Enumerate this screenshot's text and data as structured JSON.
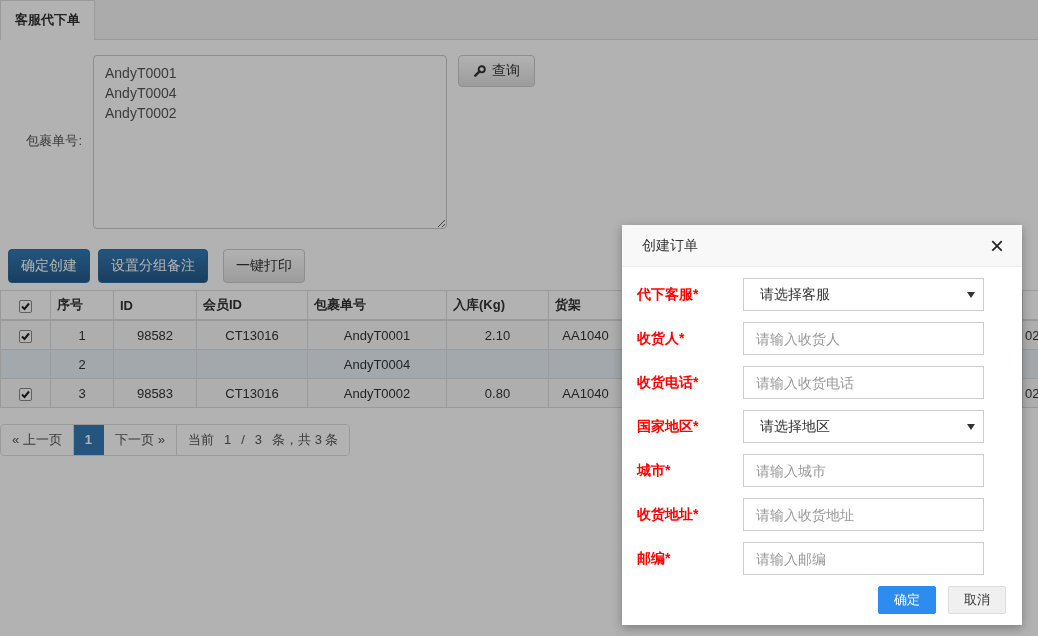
{
  "tabs": [
    {
      "label": "客服代下单",
      "selected": true
    }
  ],
  "search": {
    "label": "包裹单号:",
    "value": "AndyT0001\nAndyT0004\nAndyT0002",
    "button": "查询"
  },
  "actions": [
    {
      "label": "确定创建",
      "kind": "primary"
    },
    {
      "label": "设置分组备注",
      "kind": "primary"
    },
    {
      "label": "一键打印",
      "kind": "default"
    }
  ],
  "table": {
    "header_checked": true,
    "columns": [
      "序号",
      "ID",
      "会员ID",
      "包裹单号",
      "入库(Kg)",
      "货架"
    ],
    "rows": [
      {
        "kind": "found",
        "checked": true,
        "cells": [
          "1",
          "98582",
          "CT13016",
          "AndyT0001",
          "2.10",
          "AA1040"
        ],
        "edge_cell": "02"
      },
      {
        "kind": "missing",
        "cells": [
          "2",
          null,
          null,
          "AndyT0004",
          null,
          null
        ]
      },
      {
        "kind": "found",
        "checked": true,
        "cells": [
          "3",
          "98583",
          "CT13016",
          "AndyT0002",
          "0.80",
          "AA1040"
        ],
        "edge_cell": "02"
      }
    ]
  },
  "pagination": {
    "prev": "« 上一页",
    "pages": [
      {
        "label": "1",
        "selected": true
      }
    ],
    "next": "下一页 »",
    "info": [
      "当前",
      "1",
      "/",
      "3",
      "条，共 3 条"
    ]
  },
  "dialog": {
    "title": "创建订单",
    "close": "×",
    "fields": [
      {
        "label": "代下客服*",
        "kind": "select",
        "value": "请选择客服"
      },
      {
        "label": "收货人*",
        "kind": "text",
        "placeholder": "请输入收货人"
      },
      {
        "label": "收货电话*",
        "kind": "text",
        "placeholder": "请输入收货电话"
      },
      {
        "label": "国家地区*",
        "kind": "select",
        "value": "请选择地区"
      },
      {
        "label": "城市*",
        "kind": "text",
        "placeholder": "请输入城市"
      },
      {
        "label": "收货地址*",
        "kind": "text",
        "placeholder": "请输入收货地址"
      },
      {
        "label": "邮编*",
        "kind": "text",
        "placeholder": "请输入邮编"
      }
    ],
    "buttons": [
      {
        "label": "确定",
        "kind": "primary"
      },
      {
        "label": "取消",
        "kind": "default"
      }
    ]
  }
}
